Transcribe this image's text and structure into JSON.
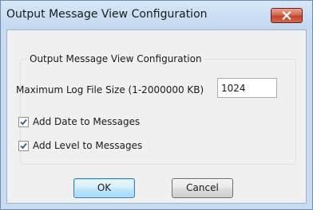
{
  "window": {
    "title": "Output Message View Configuration",
    "close_icon": "close-x-icon"
  },
  "group": {
    "legend": "Output Message View Configuration"
  },
  "log_size": {
    "label": "Maximum Log File Size (1-2000000 KB)",
    "value": "1024"
  },
  "options": [
    {
      "label": "Add Date to Messages",
      "checked": true
    },
    {
      "label": "Add Level to Messages",
      "checked": true
    }
  ],
  "buttons": {
    "ok": "OK",
    "cancel": "Cancel"
  },
  "colors": {
    "titlebar": "#c9dcf0",
    "close_button": "#c7462b",
    "dialog_background": "#f0f0f0",
    "default_button": "#bee6fd"
  }
}
